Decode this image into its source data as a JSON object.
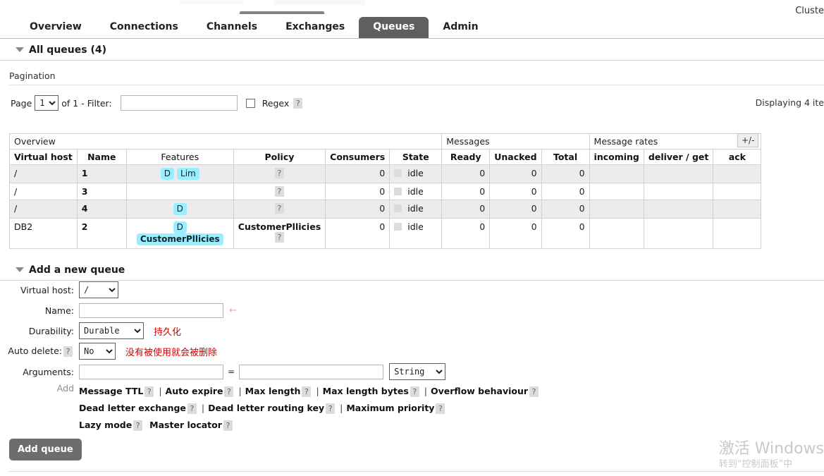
{
  "header": {
    "cluster_label": "Cluste"
  },
  "tabs": [
    {
      "label": "Overview"
    },
    {
      "label": "Connections"
    },
    {
      "label": "Channels"
    },
    {
      "label": "Exchanges"
    },
    {
      "label": "Queues"
    },
    {
      "label": "Admin"
    }
  ],
  "queues_section": {
    "title": "All queues (4)"
  },
  "pagination": {
    "title": "Pagination",
    "page_label": "Page",
    "page_value": "1",
    "of_label": "of 1",
    "filter_label": "- Filter:",
    "filter_placeholder": "",
    "regex_label": "Regex",
    "help_glyph": "?",
    "displaying": "Displaying 4 ite"
  },
  "table": {
    "groups": [
      "Overview",
      "Messages",
      "Message rates"
    ],
    "columns": [
      "Virtual host",
      "Name",
      "Features",
      "Policy",
      "Consumers",
      "State",
      "Ready",
      "Unacked",
      "Total",
      "incoming",
      "deliver / get",
      "ack"
    ],
    "plus_minus": "+/-",
    "help_glyph": "?",
    "rows": [
      {
        "virtual_host": "/",
        "name": "1",
        "features": [
          {
            "text": "D",
            "bold": false
          },
          {
            "text": "Lim",
            "bold": false
          }
        ],
        "policy": "",
        "policy_help": "?",
        "consumers": "0",
        "state": "idle",
        "ready": "0",
        "unacked": "0",
        "total": "0",
        "incoming": "",
        "deliver_get": "",
        "ack": ""
      },
      {
        "virtual_host": "/",
        "name": "3",
        "features": [],
        "policy": "",
        "policy_help": "?",
        "consumers": "0",
        "state": "idle",
        "ready": "0",
        "unacked": "0",
        "total": "0",
        "incoming": "",
        "deliver_get": "",
        "ack": ""
      },
      {
        "virtual_host": "/",
        "name": "4",
        "features": [
          {
            "text": "D",
            "bold": false
          }
        ],
        "policy": "",
        "policy_help": "?",
        "consumers": "0",
        "state": "idle",
        "ready": "0",
        "unacked": "0",
        "total": "0",
        "incoming": "",
        "deliver_get": "",
        "ack": ""
      },
      {
        "virtual_host": "DB2",
        "name": "2",
        "features": [
          {
            "text": "D",
            "bold": false
          },
          {
            "text": "CustomerPllicies",
            "bold": true
          }
        ],
        "policy": "CustomerPllicies",
        "policy_help": "?",
        "consumers": "0",
        "state": "idle",
        "ready": "0",
        "unacked": "0",
        "total": "0",
        "incoming": "",
        "deliver_get": "",
        "ack": ""
      }
    ]
  },
  "add_queue": {
    "title": "Add a new queue",
    "submit_label": "Add queue",
    "fields": {
      "virtual_host": {
        "label": "Virtual host:",
        "value": "/"
      },
      "name": {
        "label": "Name:",
        "placeholder": "",
        "marker": "←"
      },
      "durability": {
        "label": "Durability:",
        "value": "Durable",
        "note": "持久化"
      },
      "auto_delete": {
        "label": "Auto delete:",
        "help": "?",
        "value": "No",
        "note": "没有被使用就会被删除"
      },
      "arguments": {
        "label": "Arguments:",
        "key_placeholder": "",
        "value_placeholder": "",
        "equals": "=",
        "type_value": "String",
        "add_label": "Add"
      }
    },
    "presets": [
      [
        {
          "label": "Message TTL",
          "help": "?"
        },
        {
          "label": "Auto expire",
          "help": "?"
        },
        {
          "label": "Max length",
          "help": "?"
        },
        {
          "label": "Max length bytes",
          "help": "?"
        },
        {
          "label": "Overflow behaviour",
          "help": "?"
        }
      ],
      [
        {
          "label": "Dead letter exchange",
          "help": "?"
        },
        {
          "label": "Dead letter routing key",
          "help": "?"
        },
        {
          "label": "Maximum priority",
          "help": "?"
        }
      ],
      [
        {
          "label": "Lazy mode",
          "help": "?",
          "no_sep": true
        },
        {
          "label": "Master locator",
          "help": "?",
          "no_sep": true
        }
      ]
    ]
  },
  "watermark": {
    "line1": "激活 Windows",
    "line2": "转到“控制面板”中"
  }
}
